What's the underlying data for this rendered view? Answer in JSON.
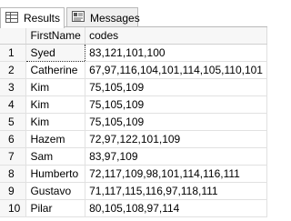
{
  "tabs": [
    {
      "label": "Results",
      "icon": "results-grid-icon",
      "active": true
    },
    {
      "label": "Messages",
      "icon": "messages-icon",
      "active": false
    }
  ],
  "grid": {
    "columns": [
      "",
      "FirstName",
      "codes"
    ],
    "rows": [
      {
        "n": "1",
        "first": "Syed",
        "codes": "83,121,101,100"
      },
      {
        "n": "2",
        "first": "Catherine",
        "codes": "67,97,116,104,101,114,105,110,101"
      },
      {
        "n": "3",
        "first": "Kim",
        "codes": "75,105,109"
      },
      {
        "n": "4",
        "first": "Kim",
        "codes": "75,105,109"
      },
      {
        "n": "5",
        "first": "Kim",
        "codes": "75,105,109"
      },
      {
        "n": "6",
        "first": "Hazem",
        "codes": "72,97,122,101,109"
      },
      {
        "n": "7",
        "first": "Sam",
        "codes": "83,97,109"
      },
      {
        "n": "8",
        "first": "Humberto",
        "codes": "72,117,109,98,101,114,116,111"
      },
      {
        "n": "9",
        "first": "Gustavo",
        "codes": "71,117,115,116,97,118,111"
      },
      {
        "n": "10",
        "first": "Pilar",
        "codes": "80,105,108,97,114"
      }
    ],
    "selected_row": 0,
    "selected_col": "first"
  },
  "colors": {
    "header_bg": "#f7f7f7",
    "grid_line": "#e1e1e1",
    "tab_border": "#b9b9b9"
  }
}
